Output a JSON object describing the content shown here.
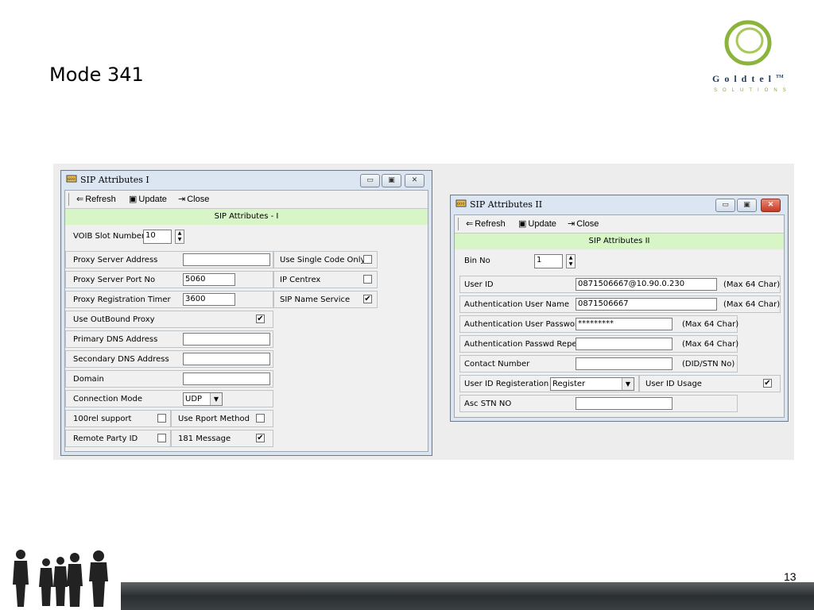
{
  "slide": {
    "title": "Mode 341",
    "page_number": "13"
  },
  "logo": {
    "name": "Goldtel",
    "tm": "TM",
    "tagline": "SOLUTIONS",
    "ring_color": "#8ab43c"
  },
  "toolbar": {
    "refresh": "Refresh",
    "update": "Update",
    "close": "Close"
  },
  "win1": {
    "title": "SIP Attributes I",
    "header": "SIP  Attributes - I",
    "voib_slot_label": "VOIB Slot Number",
    "voib_slot_value": "10",
    "proxy_server_address_label": "Proxy Server Address",
    "proxy_server_address_value": "",
    "proxy_server_port_label": "Proxy Server Port No",
    "proxy_server_port_value": "5060",
    "proxy_reg_timer_label": "Proxy Registration Timer",
    "proxy_reg_timer_value": "3600",
    "use_outbound_proxy_label": "Use OutBound Proxy",
    "use_outbound_proxy_checked": "✔",
    "primary_dns_label": "Primary DNS Address",
    "primary_dns_value": "",
    "secondary_dns_label": "Secondary DNS Address",
    "secondary_dns_value": "",
    "domain_label": "Domain",
    "domain_value": "",
    "connection_mode_label": "Connection Mode",
    "connection_mode_value": "UDP",
    "rel100_label": "100rel support",
    "rel100_checked": "",
    "use_rport_label": "Use Rport Method",
    "use_rport_checked": "",
    "remote_party_label": "Remote Party ID",
    "remote_party_checked": "",
    "msg181_label": "181 Message",
    "msg181_checked": "✔",
    "use_single_code_label": "Use Single Code Only",
    "use_single_code_checked": "",
    "ip_centrex_label": "IP Centrex",
    "ip_centrex_checked": "",
    "sip_name_service_label": "SIP Name Service",
    "sip_name_service_checked": "✔"
  },
  "win2": {
    "title": "SIP Attributes II",
    "header": "SIP Attributes II",
    "bin_no_label": "Bin No",
    "bin_no_value": "1",
    "user_id_label": "User ID",
    "user_id_value": "0871506667@10.90.0.230",
    "user_id_hint": "(Max 64 Char)",
    "auth_user_label": "Authentication User Name",
    "auth_user_value": "0871506667",
    "auth_user_hint": "(Max 64 Char)",
    "auth_pass_label": "Authentication User Password",
    "auth_pass_value": "*********",
    "auth_pass_hint": "(Max 64 Char)",
    "auth_repeat_label": "Authentication Passwd Repeat",
    "auth_repeat_value": "",
    "auth_repeat_hint": "(Max 64 Char)",
    "contact_label": "Contact Number",
    "contact_value": "",
    "contact_hint": "(DID/STN No)",
    "user_id_reg_label": "User ID Registeration",
    "user_id_reg_value": "Register",
    "user_id_usage_label": "User ID Usage",
    "user_id_usage_checked": "✔",
    "asc_stn_label": "Asc STN NO",
    "asc_stn_value": ""
  }
}
